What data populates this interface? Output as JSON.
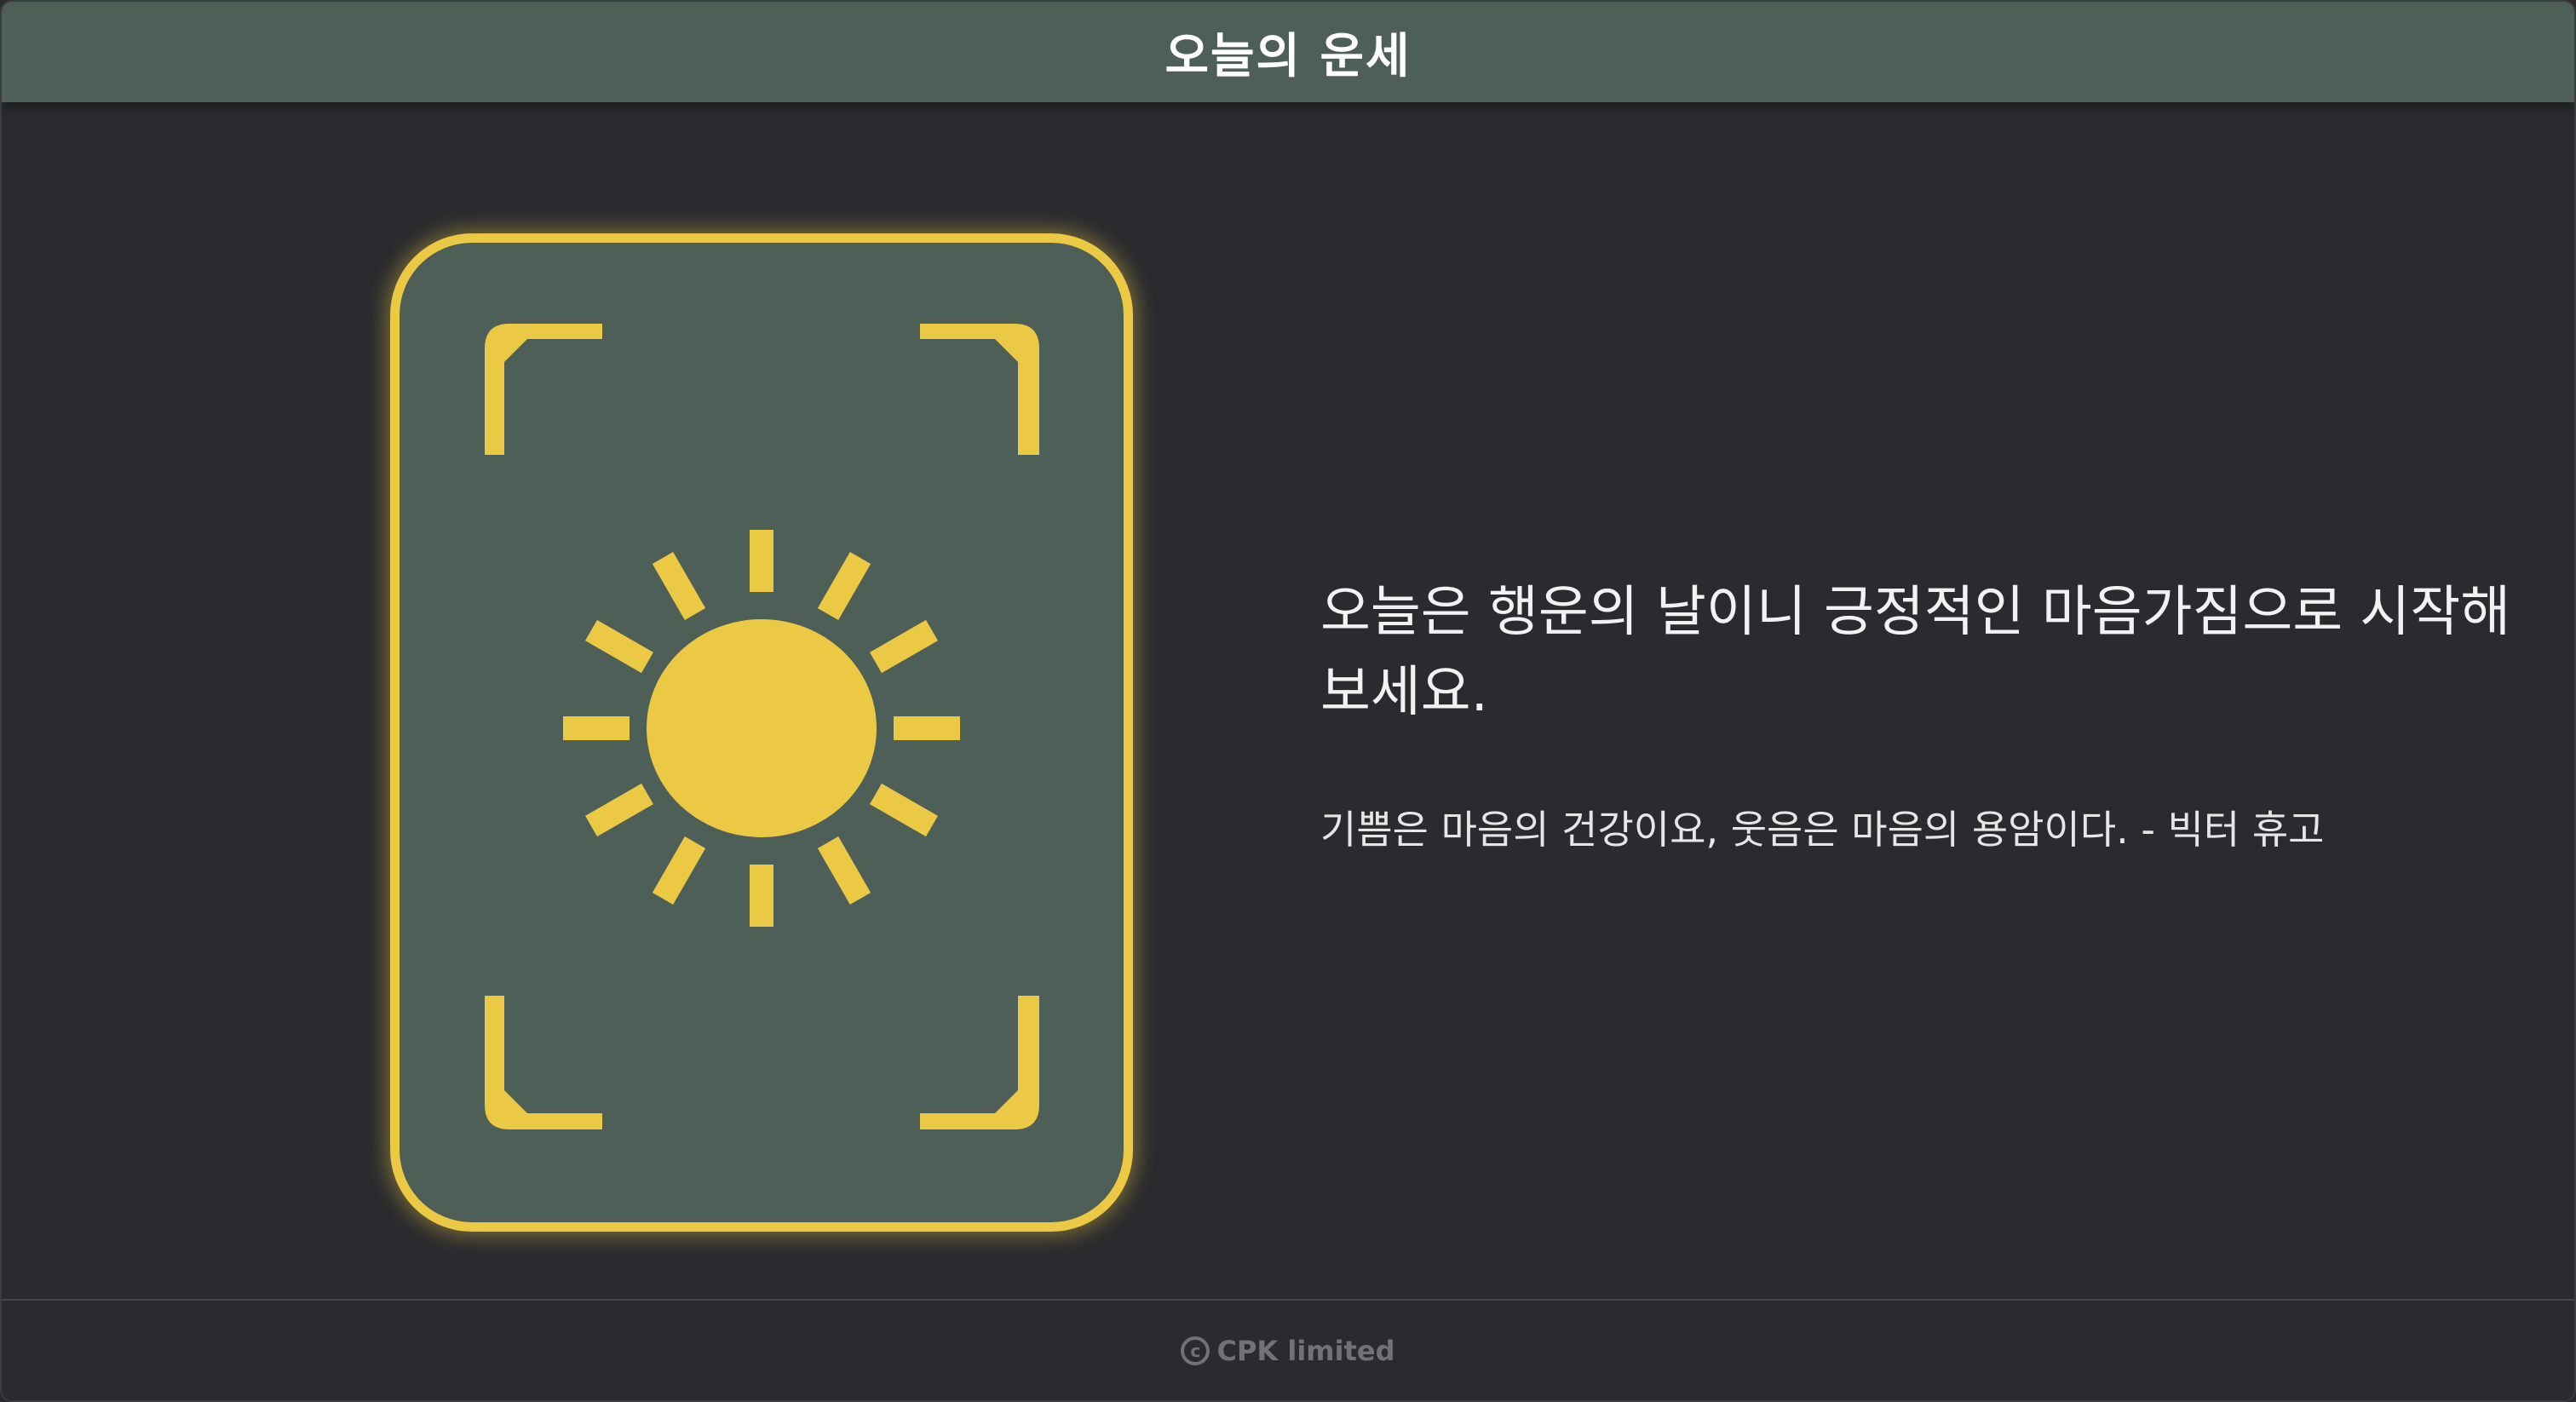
{
  "header": {
    "title": "오늘의 운세"
  },
  "fortune": {
    "message": "오늘은 행운의 날이니 긍정적인 마음가짐으로 시작해보세요.",
    "quote": "기쁨은 마음의 건강이요, 웃음은 마음의 용암이다. - 빅터 휴고",
    "card_icon": "sun-icon"
  },
  "footer": {
    "copyright_symbol": "c",
    "company": "CPK limited"
  },
  "colors": {
    "accent": "#ecc944",
    "card_background": "#4e5f57",
    "page_background": "#2a2b2e",
    "header_background": "#4e5f57"
  }
}
